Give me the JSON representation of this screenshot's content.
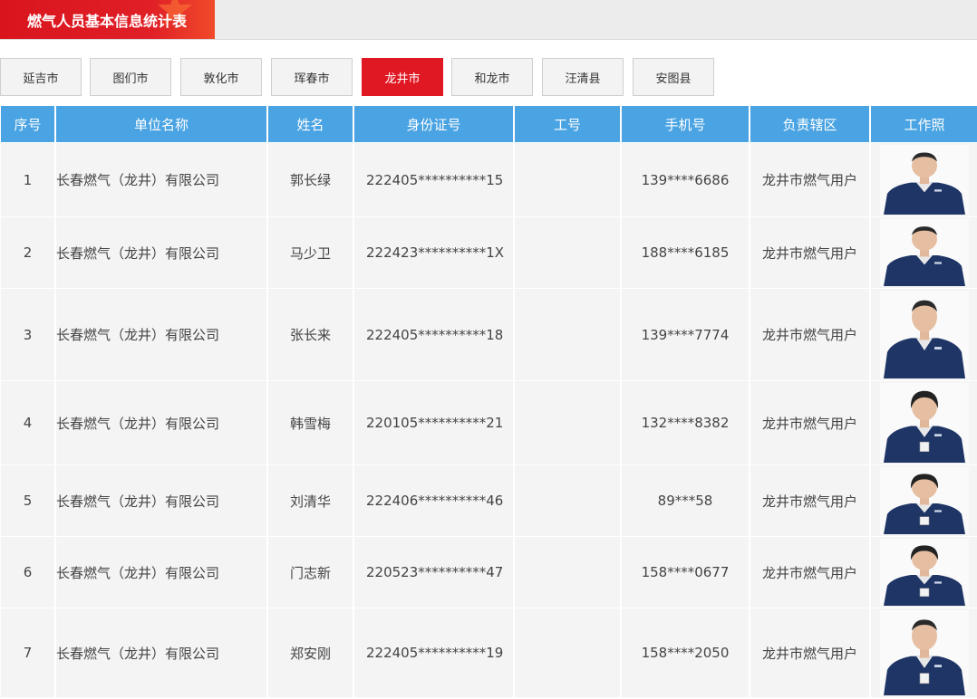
{
  "title": "燃气人员基本信息统计表",
  "cities": [
    {
      "label": "延吉市",
      "active": false
    },
    {
      "label": "图们市",
      "active": false
    },
    {
      "label": "敦化市",
      "active": false
    },
    {
      "label": "珲春市",
      "active": false
    },
    {
      "label": "龙井市",
      "active": true
    },
    {
      "label": "和龙市",
      "active": false
    },
    {
      "label": "汪清县",
      "active": false
    },
    {
      "label": "安图县",
      "active": false
    }
  ],
  "table": {
    "headers": [
      "序号",
      "单位名称",
      "姓名",
      "身份证号",
      "工号",
      "手机号",
      "负责辖区",
      "工作照"
    ],
    "rows": [
      {
        "no": "1",
        "company": "长春燃气（龙井）有限公司",
        "name": "郭长绿",
        "id_no": "222405**********15",
        "work_no": "",
        "phone": "139****6686",
        "area": "龙井市燃气用户",
        "photo": "worker-photo"
      },
      {
        "no": "2",
        "company": "长春燃气（龙井）有限公司",
        "name": "马少卫",
        "id_no": "222423**********1X",
        "work_no": "",
        "phone": "188****6185",
        "area": "龙井市燃气用户",
        "photo": "worker-photo"
      },
      {
        "no": "3",
        "company": "长春燃气（龙井）有限公司",
        "name": "张长来",
        "id_no": "222405**********18",
        "work_no": "",
        "phone": "139****7774",
        "area": "龙井市燃气用户",
        "photo": "worker-photo"
      },
      {
        "no": "4",
        "company": "长春燃气（龙井）有限公司",
        "name": "韩雪梅",
        "id_no": "220105**********21",
        "work_no": "",
        "phone": "132****8382",
        "area": "龙井市燃气用户",
        "photo": "worker-photo"
      },
      {
        "no": "5",
        "company": "长春燃气（龙井）有限公司",
        "name": "刘清华",
        "id_no": "222406**********46",
        "work_no": "",
        "phone": "89***58",
        "area": "龙井市燃气用户",
        "photo": "worker-photo"
      },
      {
        "no": "6",
        "company": "长春燃气（龙井）有限公司",
        "name": "门志新",
        "id_no": "220523**********47",
        "work_no": "",
        "phone": "158****0677",
        "area": "龙井市燃气用户",
        "photo": "worker-photo"
      },
      {
        "no": "7",
        "company": "长春燃气（龙井）有限公司",
        "name": "郑安刚",
        "id_no": "222405**********19",
        "work_no": "",
        "phone": "158****2050",
        "area": "龙井市燃气用户",
        "photo": "worker-photo"
      }
    ]
  },
  "colors": {
    "accent_red": "#e01824",
    "header_blue": "#4aa3e2",
    "uniform_navy": "#1f3566"
  }
}
